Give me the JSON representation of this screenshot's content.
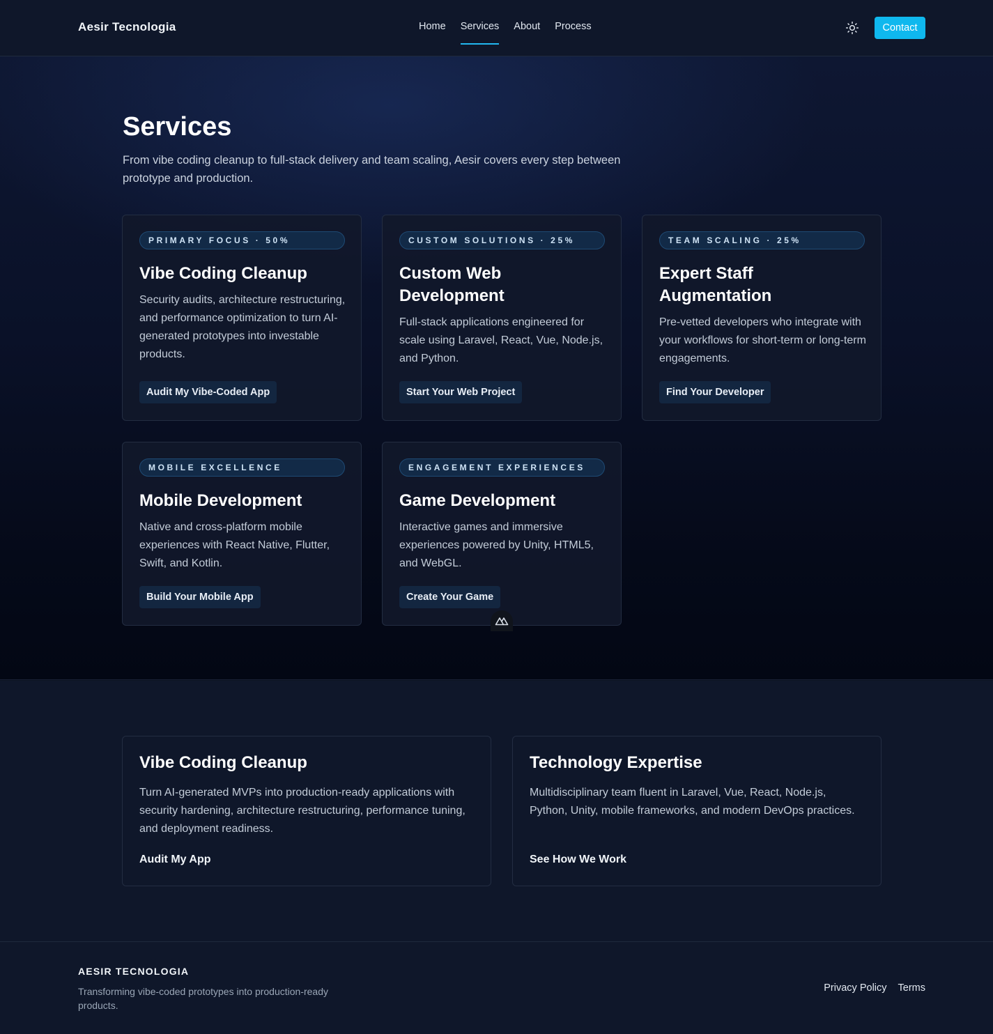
{
  "header": {
    "brand": "Aesir Tecnologia",
    "nav": [
      "Home",
      "Services",
      "About",
      "Process"
    ],
    "active_nav": "Services",
    "theme_toggle_icon": "sun-icon",
    "contact_label": "Contact"
  },
  "services": {
    "title": "Services",
    "intro": "From vibe coding cleanup to full-stack delivery and team scaling, Aesir covers every step between prototype and production.",
    "cards": [
      {
        "badge": "PRIMARY FOCUS · 50%",
        "title": "Vibe Coding Cleanup",
        "description": "Security audits, architecture restructuring, and performance optimization to turn AI-generated prototypes into investable products.",
        "button": "Audit My Vibe-Coded App"
      },
      {
        "badge": "CUSTOM SOLUTIONS · 25%",
        "title": "Custom Web Development",
        "description": "Full-stack applications engineered for scale using Laravel, React, Vue, Node.js, and Python.",
        "button": "Start Your Web Project"
      },
      {
        "badge": "TEAM SCALING · 25%",
        "title": "Expert Staff Augmentation",
        "description": "Pre-vetted developers who integrate with your workflows for short-term or long-term engagements.",
        "button": "Find Your Developer"
      },
      {
        "badge": "MOBILE EXCELLENCE",
        "title": "Mobile Development",
        "description": "Native and cross-platform mobile experiences with React Native, Flutter, Swift, and Kotlin.",
        "button": "Build Your Mobile App"
      },
      {
        "badge": "ENGAGEMENT EXPERIENCES",
        "title": "Game Development",
        "description": "Interactive games and immersive experiences powered by Unity, HTML5, and WebGL.",
        "button": "Create Your Game"
      }
    ]
  },
  "features": [
    {
      "title": "Vibe Coding Cleanup",
      "description": "Turn AI-generated MVPs into production-ready applications with security hardening, architecture restructuring, performance tuning, and deployment readiness.",
      "link": "Audit My App"
    },
    {
      "title": "Technology Expertise",
      "description": "Multidisciplinary team fluent in Laravel, Vue, React, Node.js, Python, Unity, mobile frameworks, and modern DevOps practices.",
      "link": "See How We Work"
    }
  ],
  "footer": {
    "brand": "AESIR TECNOLOGIA",
    "tagline": "Transforming vibe-coded prototypes into production-ready products.",
    "links": [
      "Privacy Policy",
      "Terms"
    ]
  },
  "colors": {
    "accent": "#0fb8ee",
    "background": "#0f172a"
  },
  "floating_icon": "nuxt-devtools-icon"
}
